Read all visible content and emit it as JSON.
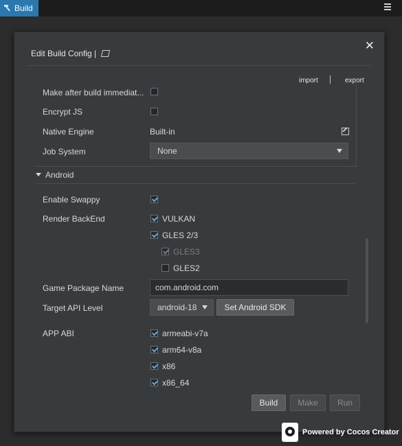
{
  "tab": {
    "title": "Build",
    "icon": "hammer-icon"
  },
  "dialog": {
    "title": "Edit Build Config |",
    "import_label": "import",
    "separator": "|",
    "export_label": "export"
  },
  "native": {
    "make_after_build_label": "Make after build immediat...",
    "encrypt_js_label": "Encrypt JS",
    "native_engine_label": "Native Engine",
    "native_engine_value": "Built-in",
    "job_system_label": "Job System",
    "job_system_value": "None"
  },
  "android": {
    "section_label": "Android",
    "enable_swappy_label": "Enable Swappy",
    "render_backend_label": "Render BackEnd",
    "backends": [
      {
        "label": "VULKAN",
        "checked": true
      },
      {
        "label": "GLES 2/3",
        "checked": true
      },
      {
        "label": "GLES3",
        "checked": true,
        "disabled": true
      },
      {
        "label": "GLES2",
        "checked": false
      }
    ],
    "package_name_label": "Game Package Name",
    "package_name_value": "com.android.com",
    "target_api_label": "Target API Level",
    "target_api_value": "android-18",
    "set_sdk_label": "Set Android SDK",
    "app_abi_label": "APP ABI",
    "abis": [
      {
        "label": "armeabi-v7a",
        "checked": true
      },
      {
        "label": "arm64-v8a",
        "checked": true
      },
      {
        "label": "x86",
        "checked": true
      },
      {
        "label": "x86_64",
        "checked": true
      }
    ]
  },
  "actions": {
    "build": "Build",
    "make": "Make",
    "run": "Run"
  },
  "footer": {
    "powered_by": "Powered by Cocos Creator",
    "logo_text": "COCOS"
  },
  "colors": {
    "tab_active": "#2a78ad",
    "checkmark": "#6aa6d6",
    "panel": "#383b3e"
  }
}
